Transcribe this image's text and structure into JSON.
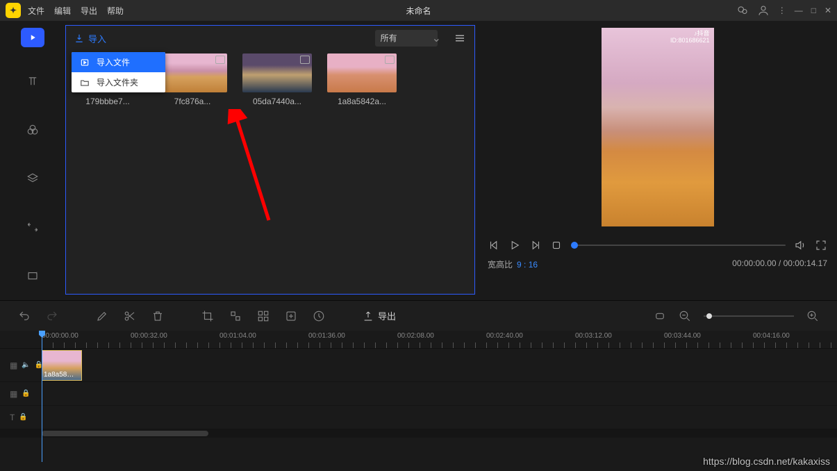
{
  "menubar": {
    "items": [
      "文件",
      "编辑",
      "导出",
      "帮助"
    ],
    "title": "未命名"
  },
  "media_panel": {
    "import_label": "导入",
    "filter_selected": "所有",
    "dropdown": {
      "import_file": "导入文件",
      "import_folder": "导入文件夹"
    },
    "thumbs": [
      {
        "name": "179bbbe7..."
      },
      {
        "name": "7fc876a..."
      },
      {
        "name": "05da7440a..."
      },
      {
        "name": "1a8a5842a..."
      }
    ]
  },
  "preview": {
    "brand": "抖音",
    "brand_id": "ID:801686621",
    "ratio_label": "宽高比",
    "ratio_value": "9 : 16",
    "time_current": "00:00:00.00",
    "time_total": "00:00:14.17"
  },
  "toolbar": {
    "export_label": "导出"
  },
  "timeline": {
    "marks": [
      "00:00:00.00",
      "00:00:32.00",
      "00:01:04.00",
      "00:01:36.00",
      "00:02:08.00",
      "00:02:40.00",
      "00:03:12.00",
      "00:03:44.00",
      "00:04:16.00"
    ],
    "clip_name": "1a8a58…"
  },
  "watermark": "https://blog.csdn.net/kakaxiss"
}
